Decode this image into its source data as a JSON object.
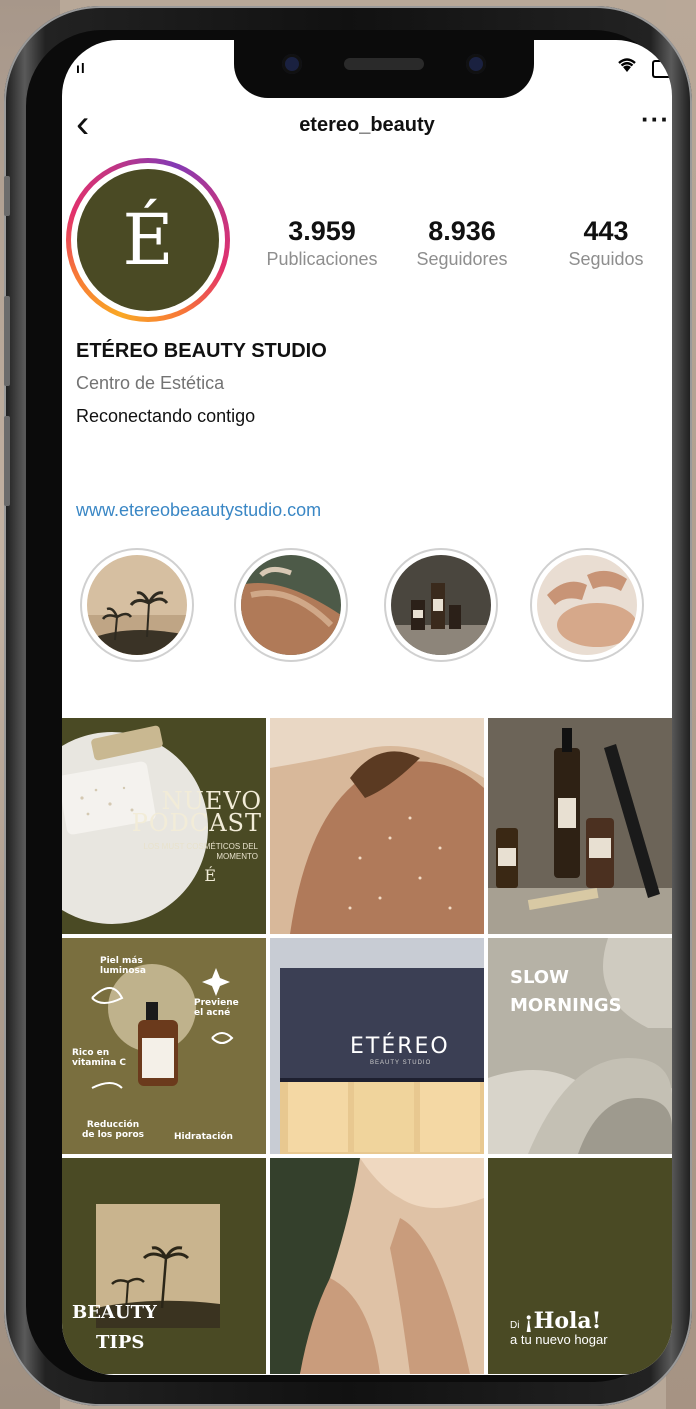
{
  "status_bar": {
    "signal": "ıl"
  },
  "nav": {
    "back_glyph": "‹",
    "username": "etereo_beauty",
    "more_glyph": "···"
  },
  "profile": {
    "avatar_letter": "É",
    "stats": [
      {
        "value": "3.959",
        "label": "Publicaciones"
      },
      {
        "value": "8.936",
        "label": "Seguidores"
      },
      {
        "value": "443",
        "label": "Seguidos"
      }
    ],
    "name": "ETÉREO BEAUTY STUDIO",
    "category": "Centro de Estética",
    "bio": "Reconectando contigo",
    "link": "www.etereobeaautystudio.com"
  },
  "highlights": [
    "palms",
    "skin",
    "bottles",
    "facial"
  ],
  "posts": {
    "podcast": {
      "title_1": "NUEVO",
      "title_2": "PODCAST",
      "subtitle": "LOS MUST COSMÉTICOS DEL MOMENTO",
      "logo": "É"
    },
    "serum": {
      "l1": "Piel más luminosa",
      "l2": "Previene el acné",
      "l3": "Rico en vitamina C",
      "l4": "Reducción de los poros",
      "l5": "Hidratación"
    },
    "store": {
      "sign": "ETÉREO",
      "sub": "BEAUTY STUDIO"
    },
    "slow": {
      "line1": "SLOW",
      "line2": "MORNINGS"
    },
    "beauty_tips": {
      "line1": "BEAUTY",
      "line2": "TIPS"
    },
    "hola": {
      "di": "Di",
      "big": "¡Hola!",
      "sub": "a tu nuevo hogar"
    }
  },
  "colors": {
    "olive": "#4a4a24",
    "olive_light": "#7a6f3f",
    "link_blue": "#3a87c5",
    "muted": "#8e8e8e"
  }
}
